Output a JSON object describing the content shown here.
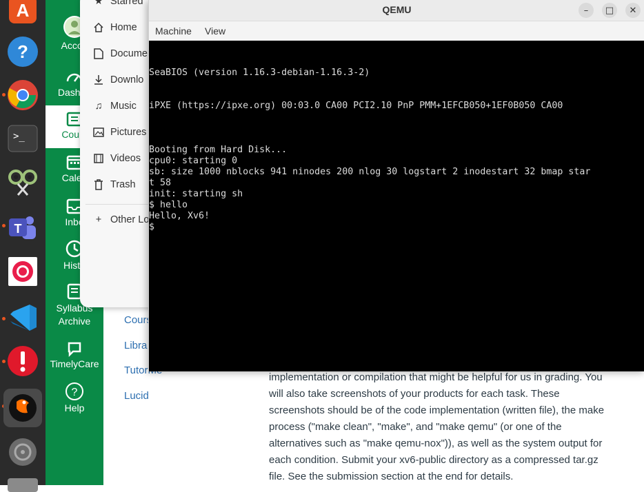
{
  "dock": {
    "apps": [
      "app-center",
      "help",
      "chrome",
      "terminal",
      "screenshot-tool",
      "teams",
      "podcast-app",
      "vscode",
      "error-reporter",
      "qemu",
      "disks"
    ]
  },
  "canvas_nav": {
    "items": [
      {
        "label": "Accou"
      },
      {
        "label": "Dashbo"
      },
      {
        "label": "Cours"
      },
      {
        "label": "Calen"
      },
      {
        "label": "Inbo"
      },
      {
        "label": "Histo"
      },
      {
        "label": "Syllabus"
      },
      {
        "label": "Archive"
      },
      {
        "label": "TimelyCare"
      },
      {
        "label": "Help"
      }
    ]
  },
  "course_links": [
    "Cours",
    "Libra",
    "TutorMe",
    "Lucid"
  ],
  "assignment_text": [
    "implementation or compilation that might be helpful for us in grading. You",
    "will also take screenshots of your products for each task. These",
    "screenshots should be of the code implementation (written file), the make",
    "process (\"make clean\", \"make\", and \"make qemu\" (or one of the",
    "alternatives such as \"make qemu-nox\")), as well as the system output for",
    "each condition. Submit your xv6-public directory as a compressed tar.gz",
    "file. See the submission section at the end for details."
  ],
  "files_panel": {
    "items": [
      {
        "label": "Starred"
      },
      {
        "label": "Home"
      },
      {
        "label": "Docume"
      },
      {
        "label": "Downlo"
      },
      {
        "label": "Music"
      },
      {
        "label": "Pictures"
      },
      {
        "label": "Videos"
      },
      {
        "label": "Trash"
      },
      {
        "label": "Other Lo"
      }
    ]
  },
  "qemu": {
    "title": "QEMU",
    "menu": [
      "Machine",
      "View"
    ],
    "buttons": {
      "minimize": "–",
      "maximize": "□",
      "close": "✕"
    },
    "terminal_lines": [
      "SeaBIOS (version 1.16.3-debian-1.16.3-2)",
      "iPXE (https://ipxe.org) 00:03.0 CA00 PCI2.10 PnP PMM+1EFCB050+1EF0B050 CA00",
      "Booting from Hard Disk...",
      "cpu0: starting 0",
      "sb: size 1000 nblocks 941 ninodes 200 nlog 30 logstart 2 inodestart 32 bmap star",
      "t 58",
      "init: starting sh",
      "$ hello",
      "Hello, Xv6!",
      "$"
    ]
  }
}
